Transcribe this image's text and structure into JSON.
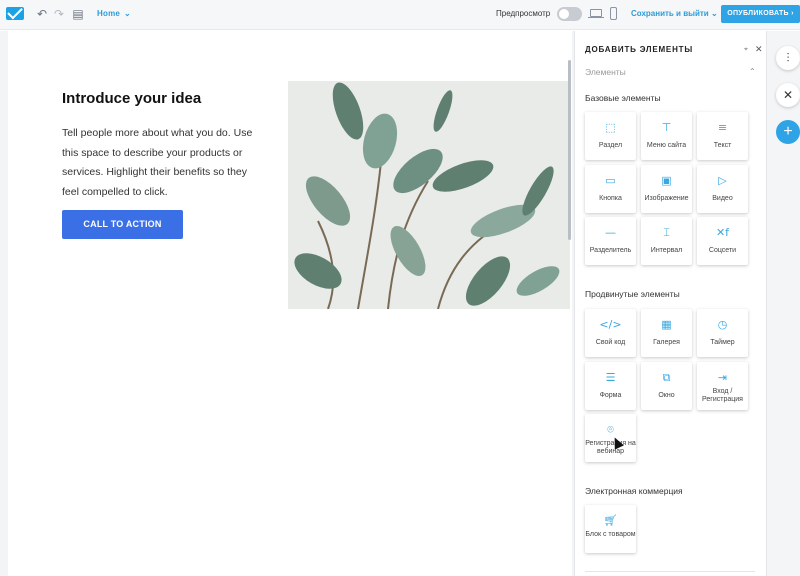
{
  "topbar": {
    "home_label": "Home",
    "preview_label": "Предпросмотр",
    "save_exit_label": "Сохранить и выйти",
    "publish_label": "ОПУБЛИКОВАТЬ",
    "preview_on": false
  },
  "section": {
    "title": "Introduce your idea",
    "text": "Tell people more about what you do. Use this space to describe your products or services. Highlight their benefits so they feel compelled to click.",
    "cta_label": "CALL TO ACTION"
  },
  "panel": {
    "title": "ДОБАВИТЬ ЭЛЕМЕНТЫ",
    "subheader": "Элементы",
    "groups": {
      "basic": {
        "title": "Базовые элементы",
        "items": [
          {
            "label": "Раздел",
            "icon": "section-icon"
          },
          {
            "label": "Меню сайта",
            "icon": "menu-icon"
          },
          {
            "label": "Текст",
            "icon": "text-icon"
          },
          {
            "label": "Кнопка",
            "icon": "button-icon"
          },
          {
            "label": "Изображение",
            "icon": "image-icon"
          },
          {
            "label": "Видео",
            "icon": "video-icon"
          },
          {
            "label": "Разделитель",
            "icon": "divider-icon"
          },
          {
            "label": "Интервал",
            "icon": "spacer-icon"
          },
          {
            "label": "Соцсети",
            "icon": "social-icon"
          }
        ]
      },
      "advanced": {
        "title": "Продвинутые элементы",
        "items": [
          {
            "label": "Свой код",
            "icon": "code-icon"
          },
          {
            "label": "Галерея",
            "icon": "gallery-icon"
          },
          {
            "label": "Таймер",
            "icon": "timer-icon"
          },
          {
            "label": "Форма",
            "icon": "form-icon"
          },
          {
            "label": "Окно",
            "icon": "popup-icon"
          },
          {
            "label": "Вход / Регистрация",
            "icon": "login-icon"
          },
          {
            "label": "Регистрация на вебинар",
            "icon": "webinar-icon"
          }
        ]
      },
      "ecommerce": {
        "title": "Электронная коммерция",
        "items": [
          {
            "label": "Блок с товаром",
            "icon": "cart-icon"
          }
        ]
      }
    }
  },
  "colors": {
    "accent": "#2ea3e6",
    "cta": "#3b6fe6"
  }
}
